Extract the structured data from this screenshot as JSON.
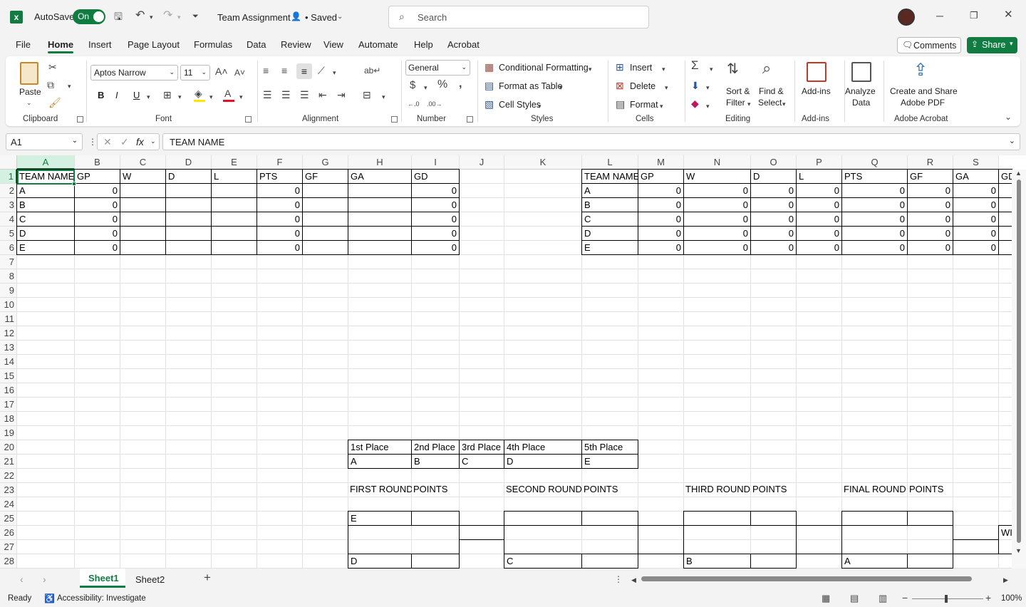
{
  "titlebar": {
    "autosave_label": "AutoSave",
    "autosave_state": "On",
    "doc_title": "Team Assignment",
    "saved_status": "• Saved",
    "search_placeholder": "Search"
  },
  "menu": [
    "File",
    "Home",
    "Insert",
    "Page Layout",
    "Formulas",
    "Data",
    "Review",
    "View",
    "Automate",
    "Help",
    "Acrobat"
  ],
  "menu_active": "Home",
  "menu_right": {
    "comments": "Comments",
    "share": "Share"
  },
  "ribbon": {
    "clipboard": {
      "paste": "Paste",
      "label": "Clipboard"
    },
    "font": {
      "family": "Aptos Narrow",
      "size": "11",
      "label": "Font",
      "bold": "B",
      "italic": "I",
      "underline": "U"
    },
    "alignment": {
      "label": "Alignment"
    },
    "number": {
      "format": "General",
      "label": "Number"
    },
    "styles": {
      "conditional": "Conditional Formatting",
      "format_table": "Format as Table",
      "cell_styles": "Cell Styles",
      "label": "Styles"
    },
    "cells": {
      "insert": "Insert",
      "delete": "Delete",
      "format": "Format",
      "label": "Cells"
    },
    "editing": {
      "sort1": "Sort &",
      "sort2": "Filter",
      "find1": "Find &",
      "find2": "Select",
      "label": "Editing"
    },
    "addins": {
      "btn": "Add-ins",
      "label": "Add-ins"
    },
    "analyze": {
      "line1": "Analyze",
      "line2": "Data"
    },
    "acrobat": {
      "line1": "Create and Share",
      "line2": "Adobe PDF",
      "label": "Adobe Acrobat"
    }
  },
  "formula_bar": {
    "name_box": "A1",
    "formula": "TEAM NAME"
  },
  "columns": [
    "A",
    "B",
    "C",
    "D",
    "E",
    "F",
    "G",
    "H",
    "I",
    "J",
    "K",
    "L",
    "M",
    "N",
    "O",
    "P",
    "Q",
    "R",
    "S"
  ],
  "rows": [
    "1",
    "2",
    "3",
    "4",
    "5",
    "6",
    "7",
    "8",
    "9",
    "10",
    "11",
    "12",
    "13",
    "14",
    "15",
    "16",
    "17",
    "18",
    "19",
    "20",
    "21",
    "22",
    "23",
    "24",
    "25",
    "26",
    "27",
    "28"
  ],
  "table1": {
    "headers": [
      "TEAM NAME",
      "GP",
      "W",
      "D",
      "L",
      "PTS",
      "GF",
      "GA",
      "GD"
    ],
    "rows": [
      [
        "A",
        "0",
        "",
        "",
        "",
        "0",
        "",
        "",
        "0"
      ],
      [
        "B",
        "0",
        "",
        "",
        "",
        "0",
        "",
        "",
        "0"
      ],
      [
        "C",
        "0",
        "",
        "",
        "",
        "0",
        "",
        "",
        "0"
      ],
      [
        "D",
        "0",
        "",
        "",
        "",
        "0",
        "",
        "",
        "0"
      ],
      [
        "E",
        "0",
        "",
        "",
        "",
        "0",
        "",
        "",
        "0"
      ]
    ]
  },
  "table2": {
    "headers": [
      "TEAM NAME",
      "GP",
      "W",
      "D",
      "L",
      "PTS",
      "GF",
      "GA",
      "GD"
    ],
    "rows": [
      [
        "A",
        "0",
        "0",
        "0",
        "0",
        "0",
        "0",
        "0"
      ],
      [
        "B",
        "0",
        "0",
        "0",
        "0",
        "0",
        "0",
        "0"
      ],
      [
        "C",
        "0",
        "0",
        "0",
        "0",
        "0",
        "0",
        "0"
      ],
      [
        "D",
        "0",
        "0",
        "0",
        "0",
        "0",
        "0",
        "0"
      ],
      [
        "E",
        "0",
        "0",
        "0",
        "0",
        "0",
        "0",
        "0"
      ]
    ]
  },
  "places": {
    "headers": [
      "1st Place",
      "2nd Place",
      "3rd Place",
      "4th Place",
      "5th Place"
    ],
    "values": [
      "A",
      "B",
      "C",
      "D",
      "E"
    ]
  },
  "rounds": {
    "first": "FIRST ROUND",
    "second": "SECOND ROUND",
    "third": "THIRD ROUND",
    "final": "FINAL ROUND",
    "points": "POINTS",
    "r25_first": "E",
    "r28_first": "D",
    "r28_second": "C",
    "r28_third": "B",
    "r28_final": "A",
    "r26_winner": "WI"
  },
  "sheets": [
    "Sheet1",
    "Sheet2"
  ],
  "active_sheet": "Sheet1",
  "status": {
    "ready": "Ready",
    "accessibility": "Accessibility: Investigate",
    "zoom": "100%"
  }
}
